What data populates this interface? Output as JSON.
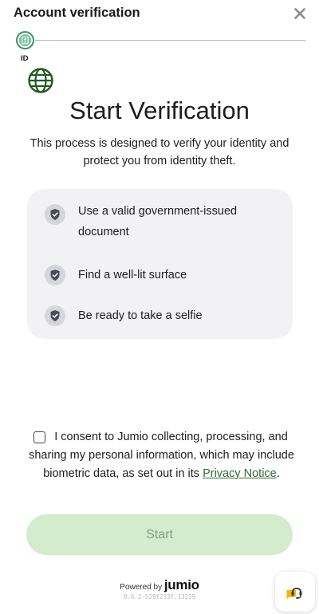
{
  "header": {
    "title": "Account verification",
    "close_icon": "close-icon"
  },
  "stepper": {
    "steps": [
      {
        "label": "ID",
        "icon": "id-card-icon",
        "active": true
      }
    ],
    "accent_color": "#3f8f6c"
  },
  "main": {
    "icon": "globe-icon",
    "title": "Start Verification",
    "subtitle": "This process is designed to verify your identity and protect you from identity theft.",
    "tips": [
      {
        "icon": "shield-check-icon",
        "text": "Use a valid government-issued document"
      },
      {
        "icon": "shield-check-icon",
        "text": "Find a well-lit surface"
      },
      {
        "icon": "shield-check-icon",
        "text": "Be ready to take a selfie"
      }
    ]
  },
  "consent": {
    "checked": false,
    "text": "I consent to Jumio collecting, processing, and sharing my personal information, which may include biometric data, as set out in its",
    "link_text": "Privacy Notice",
    "trailing": "."
  },
  "start_button": {
    "label": "Start",
    "enabled": false,
    "color": "#d3eccc"
  },
  "footer": {
    "powered_by": "Powered by",
    "brand": "jumio",
    "version": "0.6.2-529f233f.13259"
  },
  "help_button": {
    "icon": "support-icon"
  }
}
